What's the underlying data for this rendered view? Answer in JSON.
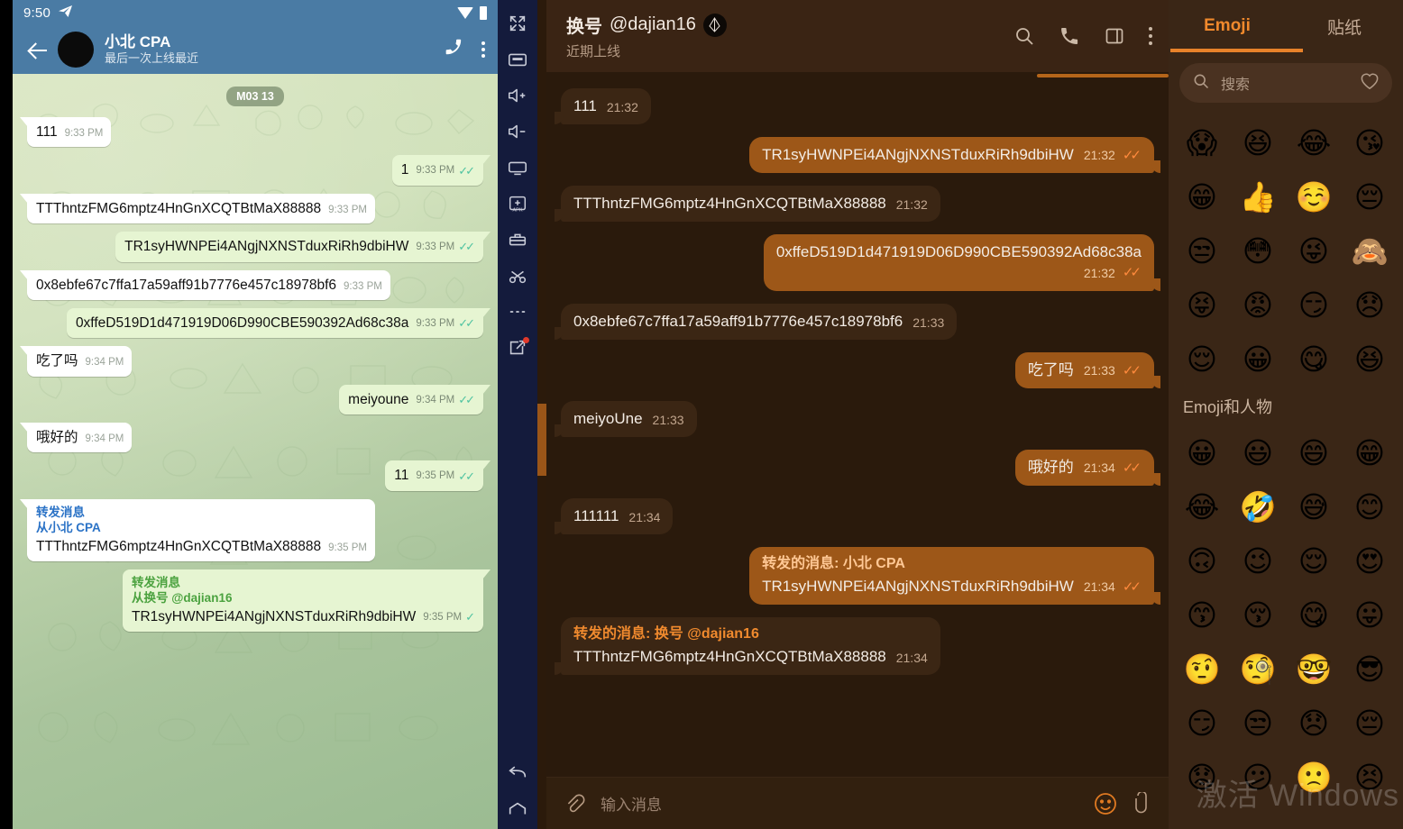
{
  "whatsapp": {
    "status_bar": {
      "time": "9:50",
      "telegram_icon": "telegram-send-icon",
      "wifi_icon": "wifi-icon",
      "battery_icon": "battery-icon"
    },
    "app_bar": {
      "back_icon": "back-arrow-icon",
      "avatar": "contact-avatar",
      "title": "小北 CPA",
      "subtitle": "最后一次上线最近",
      "call_icon": "phone-icon",
      "menu_icon": "overflow-menu-icon"
    },
    "date_chip": "M03 13",
    "messages": [
      {
        "dir": "in",
        "text": "111",
        "time": "9:33 PM",
        "ticks": ""
      },
      {
        "dir": "out",
        "text": "1",
        "time": "9:33 PM",
        "ticks": "✓✓"
      },
      {
        "dir": "in",
        "text": "TTThntzFMG6mptz4HnGnXCQTBtMaX88888",
        "time": "9:33 PM",
        "ticks": ""
      },
      {
        "dir": "out",
        "text": "TR1syHWNPEi4ANgjNXNSTduxRiRh9dbiHW",
        "time": "9:33 PM",
        "ticks": "✓✓"
      },
      {
        "dir": "in",
        "text": "0x8ebfe67c7ffa17a59aff91b7776e457c18978bf6",
        "time": "9:33 PM",
        "ticks": ""
      },
      {
        "dir": "out",
        "text": "0xffeD519D1d471919D06D990CBE590392Ad68c38a",
        "time": "9:33 PM",
        "ticks": "✓✓"
      },
      {
        "dir": "in",
        "text": "吃了吗",
        "time": "9:34 PM",
        "ticks": ""
      },
      {
        "dir": "out",
        "text": "meiyoune",
        "time": "9:34 PM",
        "ticks": "✓✓"
      },
      {
        "dir": "in",
        "text": "哦好的",
        "time": "9:34 PM",
        "ticks": ""
      },
      {
        "dir": "out",
        "text": "11",
        "time": "9:35 PM",
        "ticks": "✓✓"
      },
      {
        "dir": "in",
        "fwd_line1": "转发消息",
        "fwd_line2": "从小北 CPA",
        "text": "TTThntzFMG6mptz4HnGnXCQTBtMaX88888",
        "time": "9:35 PM",
        "ticks": ""
      },
      {
        "dir": "out",
        "fwd_line1": "转发消息",
        "fwd_line2": "从换号 @dajian16",
        "text": "TR1syHWNPEi4ANgjNXNSTduxRiRh9dbiHW",
        "time": "9:35 PM",
        "ticks": "✓"
      }
    ]
  },
  "emulator_toolbar": {
    "buttons": [
      {
        "name": "fullscreen-icon",
        "label": "Fullscreen"
      },
      {
        "name": "keyboard-icon",
        "label": "Keyboard"
      },
      {
        "name": "volume-up-icon",
        "label": "Volume up"
      },
      {
        "name": "volume-down-icon",
        "label": "Volume down"
      },
      {
        "name": "screen-icon",
        "label": "Screen"
      },
      {
        "name": "install-apk-icon",
        "label": "Install APK"
      },
      {
        "name": "toolbox-icon",
        "label": "Tools"
      },
      {
        "name": "scissors-icon",
        "label": "Cut"
      },
      {
        "name": "more-options-icon",
        "label": "More"
      },
      {
        "name": "share-icon",
        "label": "Share",
        "badge": true
      }
    ],
    "nav": [
      {
        "name": "back-nav-icon",
        "label": "Back"
      },
      {
        "name": "home-nav-icon",
        "label": "Home"
      }
    ]
  },
  "telegram": {
    "header": {
      "title_name": "换号",
      "title_username": "@dajian16",
      "badge_icon": "eos-diamond-icon",
      "subtitle": "近期上线",
      "search_icon": "search-icon",
      "call_icon": "phone-icon",
      "panel_icon": "split-view-icon",
      "menu_icon": "overflow-menu-icon"
    },
    "messages": [
      {
        "dir": "in",
        "text": "111",
        "time": "21:32",
        "ticks": ""
      },
      {
        "dir": "out",
        "text": "TR1syHWNPEi4ANgjNXNSTduxRiRh9dbiHW",
        "time": "21:32",
        "ticks": "✓✓"
      },
      {
        "dir": "in",
        "text": "TTThntzFMG6mptz4HnGnXCQTBtMaX88888",
        "time": "21:32",
        "ticks": ""
      },
      {
        "dir": "out",
        "text": "0xffeD519D1d471919D06D990CBE590392Ad68c38a",
        "time": "21:32",
        "ticks": "✓✓",
        "meta_below": true
      },
      {
        "dir": "in",
        "text": "0x8ebfe67c7ffa17a59aff91b7776e457c18978bf6",
        "time": "21:33",
        "ticks": ""
      },
      {
        "dir": "out",
        "text": "吃了吗",
        "time": "21:33",
        "ticks": "✓✓"
      },
      {
        "dir": "in",
        "text": "meiyoUne",
        "time": "21:33",
        "ticks": ""
      },
      {
        "dir": "out",
        "text": "哦好的",
        "time": "21:34",
        "ticks": "✓✓"
      },
      {
        "dir": "in",
        "text": "111111",
        "time": "21:34",
        "ticks": ""
      },
      {
        "dir": "out",
        "fwd_header": "转发的消息: 小北 CPA",
        "text": "TR1syHWNPEi4ANgjNXNSTduxRiRh9dbiHW",
        "time": "21:34",
        "ticks": "✓✓"
      },
      {
        "dir": "in",
        "fwd_header": "转发的消息: 换号 @dajian16",
        "text": "TTThntzFMG6mptz4HnGnXCQTBtMaX88888",
        "time": "21:34",
        "ticks": ""
      }
    ],
    "input": {
      "attach_icon": "paperclip-spiral-icon",
      "placeholder": "输入消息",
      "emoji_icon": "emoji-smiley-icon",
      "clip_icon": "attachment-icon"
    },
    "emoji_panel": {
      "tabs": [
        {
          "label": "Emoji",
          "active": true
        },
        {
          "label": "贴纸",
          "active": false
        }
      ],
      "search": {
        "icon": "search-icon",
        "placeholder": "搜索",
        "favorite_icon": "heart-icon"
      },
      "recent": [
        "😱",
        "😆",
        "😂",
        "😘",
        "😁",
        "👍",
        "☺️",
        "😔",
        "😒",
        "😳",
        "😜",
        "🙈",
        "😝",
        "😡",
        "😏",
        "😞",
        "😌",
        "😀",
        "😋",
        "😆"
      ],
      "section_title": "Emoji和人物",
      "people": [
        "😀",
        "😃",
        "😄",
        "😁",
        "😂",
        "🤣",
        "😅",
        "😊",
        "🙃",
        "😉",
        "😌",
        "😍",
        "😙",
        "😚",
        "😋",
        "😛",
        "🤨",
        "🧐",
        "🤓",
        "😎",
        "😏",
        "😒",
        "😞",
        "😔",
        "😟",
        "😕",
        "🙁",
        "😣"
      ]
    },
    "watermark": "激活 Windows"
  }
}
